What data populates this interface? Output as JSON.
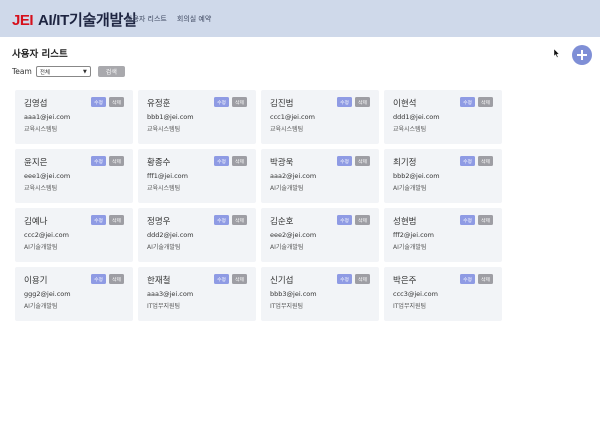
{
  "header": {
    "logo": "JEI",
    "title": "AI/IT기술개발실",
    "nav": [
      "사용자 리스트",
      "회의실 예약"
    ]
  },
  "page": {
    "title": "사용자 리스트",
    "filter_label": "Team",
    "team_select_value": "전체",
    "search_label": "검색",
    "add_icon": "plus-circle-icon",
    "cursor_icon": "mouse-pointer-icon"
  },
  "card_actions": {
    "edit_label": "수정",
    "delete_label": "삭제"
  },
  "colors": {
    "header_bg": "#cfd9ea",
    "brand_red": "#d6101c",
    "edit_button": "#8f9be4",
    "delete_button": "#9e9ea4",
    "add_button": "#7f8fd6",
    "card_bg": "#f2f4f7"
  },
  "users": [
    {
      "name": "김영섭",
      "email": "aaa1@jei.com",
      "team": "교육시스템팀"
    },
    {
      "name": "유정훈",
      "email": "bbb1@jei.com",
      "team": "교육시스템팀"
    },
    {
      "name": "김진범",
      "email": "ccc1@jei.com",
      "team": "교육시스템팀"
    },
    {
      "name": "이현석",
      "email": "ddd1@jei.com",
      "team": "교육시스템팀"
    },
    {
      "name": "윤지은",
      "email": "eee1@jei.com",
      "team": "교육시스템팀"
    },
    {
      "name": "황종수",
      "email": "fff1@jei.com",
      "team": "교육시스템팀"
    },
    {
      "name": "박광욱",
      "email": "aaa2@jei.com",
      "team": "AI기술개발팀"
    },
    {
      "name": "최기정",
      "email": "bbb2@jei.com",
      "team": "AI기술개발팀"
    },
    {
      "name": "김예나",
      "email": "ccc2@jei.com",
      "team": "AI기술개발팀"
    },
    {
      "name": "정명우",
      "email": "ddd2@jei.com",
      "team": "AI기술개발팀"
    },
    {
      "name": "김순호",
      "email": "eee2@jei.com",
      "team": "AI기술개발팀"
    },
    {
      "name": "성현범",
      "email": "fff2@jei.com",
      "team": "AI기술개발팀"
    },
    {
      "name": "이용기",
      "email": "ggg2@jei.com",
      "team": "AI기술개발팀"
    },
    {
      "name": "한재철",
      "email": "aaa3@jei.com",
      "team": "IT업무지원팀"
    },
    {
      "name": "신기섭",
      "email": "bbb3@jei.com",
      "team": "IT업무지원팀"
    },
    {
      "name": "박은주",
      "email": "ccc3@jei.com",
      "team": "IT업무지원팀"
    }
  ]
}
